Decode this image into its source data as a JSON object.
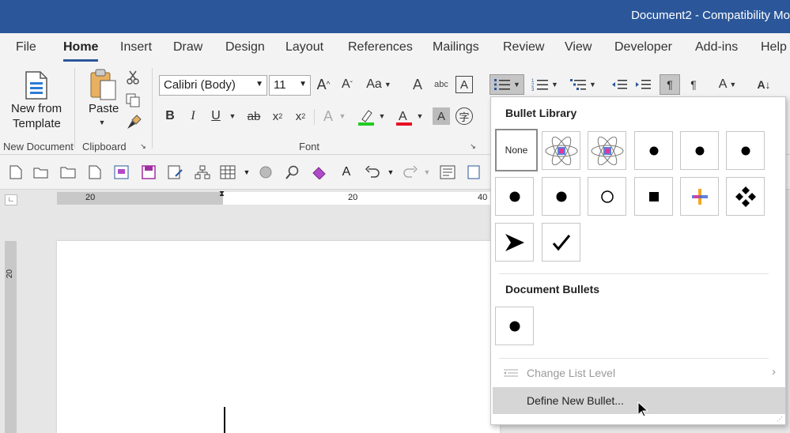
{
  "window": {
    "title": "Document2  -  Compatibility Mo"
  },
  "tabs": [
    "File",
    "Home",
    "Insert",
    "Draw",
    "Design",
    "Layout",
    "References",
    "Mailings",
    "Review",
    "View",
    "Developer",
    "Add-ins",
    "Help"
  ],
  "ribbon": {
    "new_document": {
      "button_line1": "New from",
      "button_line2": "Template",
      "group_label": "New Document"
    },
    "clipboard": {
      "paste_label": "Paste",
      "group_label": "Clipboard"
    },
    "font": {
      "font_name": "Calibri (Body)",
      "font_size": "11",
      "group_label": "Font",
      "aa_label": "Aa",
      "bold": "B",
      "italic": "I",
      "underline": "U",
      "strike": "ab",
      "subscript": "x",
      "superscript": "x",
      "sub_mark": "2",
      "sup_mark": "2",
      "grow": "A",
      "shrink": "A",
      "effects": "A",
      "highlight_color": "#22cc22",
      "font_color": "#e81123"
    }
  },
  "ruler": {
    "h_label_left": "20",
    "h_label_mid": "20",
    "h_label_right": "40",
    "v_label": "20"
  },
  "bullet_menu": {
    "library_title": "Bullet Library",
    "none_label": "None",
    "document_bullets_title": "Document Bullets",
    "change_list_level": "Change List Level",
    "define_new_bullet": "Define New Bullet..."
  }
}
